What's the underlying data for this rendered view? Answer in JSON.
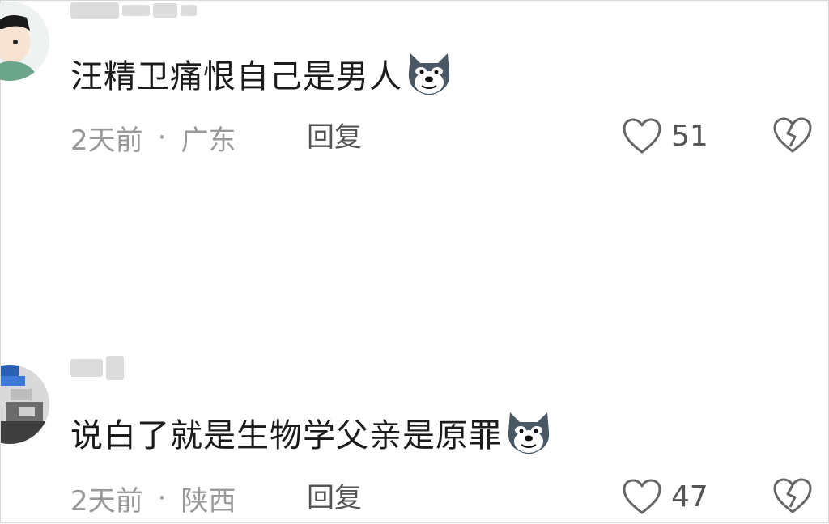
{
  "comments": [
    {
      "text": "汪精卫痛恨自己是男人",
      "time": "2天前",
      "separator": "·",
      "location": "广东",
      "reply_label": "回复",
      "likes": "51",
      "avatar_icon": "cartoon-boy-avatar-icon",
      "emoji_icon": "husky-smirk-emoji-icon"
    },
    {
      "text": "说白了就是生物学父亲是原罪",
      "time": "2天前",
      "separator": "·",
      "location": "陕西",
      "reply_label": "回复",
      "likes": "47",
      "avatar_icon": "photo-avatar-icon",
      "emoji_icon": "husky-smirk-emoji-icon"
    }
  ],
  "colors": {
    "text": "#1b1b1b",
    "meta": "#999999",
    "action": "#555555",
    "icon": "#666666"
  }
}
